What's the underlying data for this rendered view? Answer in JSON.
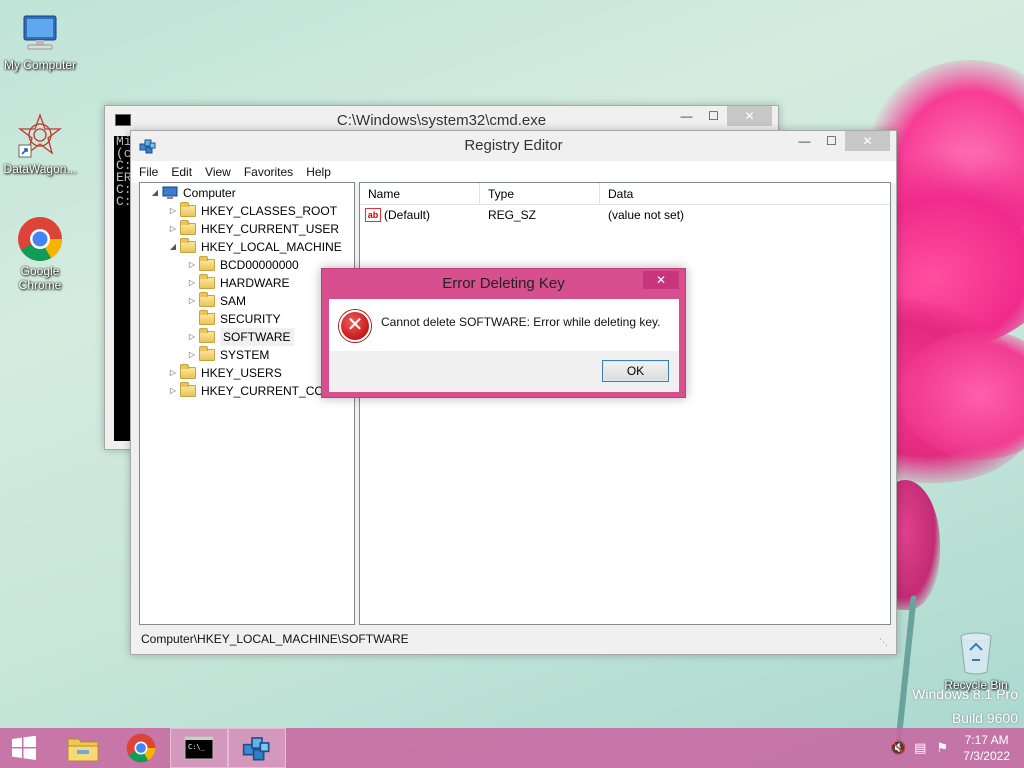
{
  "desktop": {
    "icons": [
      {
        "label": "My Computer",
        "icon": "my-computer-icon"
      },
      {
        "label": "DataWagon...",
        "icon": "datawagon-icon"
      },
      {
        "label": "Google Chrome",
        "icon": "chrome-icon"
      },
      {
        "label": "Recycle Bin",
        "icon": "recycle-bin-icon"
      }
    ],
    "watermark": {
      "line1": "Windows 8.1 Pro",
      "line2": "Build 9600"
    }
  },
  "cmd_window": {
    "title": "C:\\Windows\\system32\\cmd.exe",
    "lines": [
      "Mi",
      "(c",
      "",
      "C:",
      "ER",
      "",
      "C:",
      "",
      "C:"
    ]
  },
  "regedit": {
    "title": "Registry Editor",
    "menu": [
      "File",
      "Edit",
      "View",
      "Favorites",
      "Help"
    ],
    "tree": {
      "root": "Computer",
      "items": [
        {
          "label": "HKEY_CLASSES_ROOT",
          "level": 1,
          "expander": "▷"
        },
        {
          "label": "HKEY_CURRENT_USER",
          "level": 1,
          "expander": "▷"
        },
        {
          "label": "HKEY_LOCAL_MACHINE",
          "level": 1,
          "expander": "◢"
        },
        {
          "label": "BCD00000000",
          "level": 2,
          "expander": "▷"
        },
        {
          "label": "HARDWARE",
          "level": 2,
          "expander": "▷"
        },
        {
          "label": "SAM",
          "level": 2,
          "expander": "▷"
        },
        {
          "label": "SECURITY",
          "level": 2,
          "expander": ""
        },
        {
          "label": "SOFTWARE",
          "level": 2,
          "expander": "▷",
          "selected": true
        },
        {
          "label": "SYSTEM",
          "level": 2,
          "expander": "▷"
        },
        {
          "label": "HKEY_USERS",
          "level": 1,
          "expander": "▷"
        },
        {
          "label": "HKEY_CURRENT_CONF",
          "level": 1,
          "expander": "▷"
        }
      ]
    },
    "list": {
      "columns": [
        "Name",
        "Type",
        "Data"
      ],
      "rows": [
        {
          "name": "(Default)",
          "type": "REG_SZ",
          "data": "(value not set)"
        }
      ]
    },
    "status": "Computer\\HKEY_LOCAL_MACHINE\\SOFTWARE"
  },
  "error_dialog": {
    "title": "Error Deleting Key",
    "message": "Cannot delete SOFTWARE:  Error while deleting key.",
    "ok_label": "OK",
    "accent": "#d74f8f"
  },
  "taskbar": {
    "color": "#c766a0",
    "buttons": [
      "start-icon",
      "file-explorer-icon",
      "chrome-icon",
      "cmd-icon",
      "regedit-icon"
    ],
    "clock": {
      "time": "7:17 AM",
      "date": "7/3/2022"
    }
  }
}
